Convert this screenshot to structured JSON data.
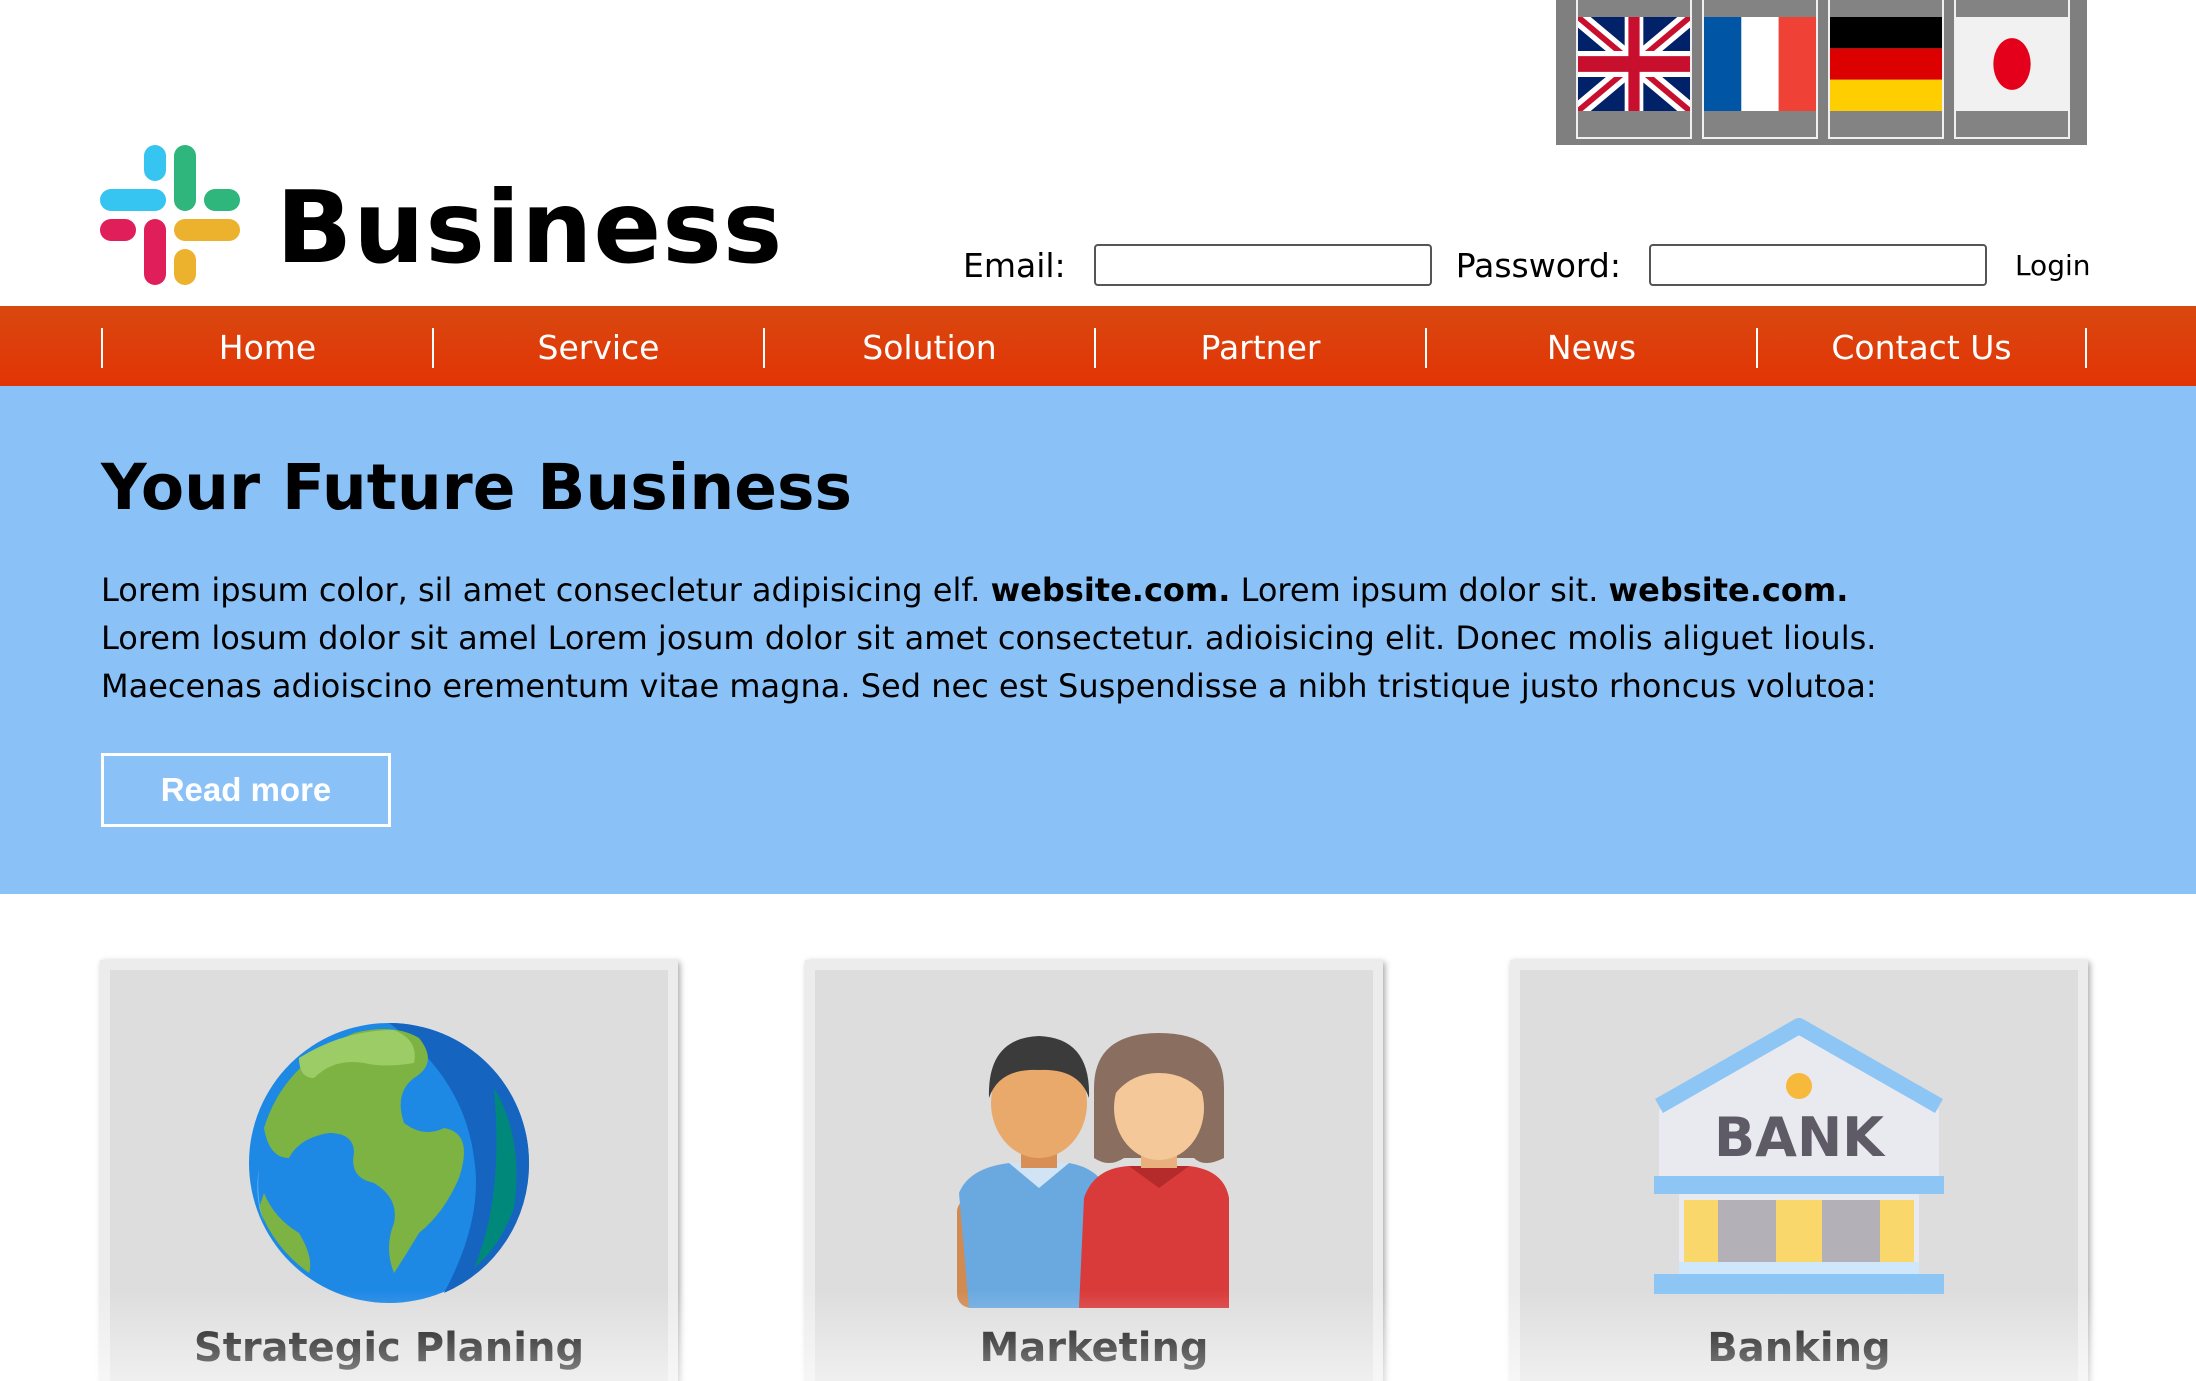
{
  "header": {
    "brand": "Business",
    "logo_icon": "slack-hash-logo-icon",
    "languages": [
      {
        "name": "English",
        "icon": "uk-flag-icon"
      },
      {
        "name": "French",
        "icon": "france-flag-icon"
      },
      {
        "name": "German",
        "icon": "germany-flag-icon"
      },
      {
        "name": "Japanese",
        "icon": "japan-flag-icon"
      }
    ],
    "email_label": "Email:",
    "email_value": "",
    "password_label": "Password:",
    "password_value": "",
    "login_label": "Login"
  },
  "nav": {
    "items": [
      "Home",
      "Service",
      "Solution",
      "Partner",
      "News",
      "Contact Us"
    ],
    "bg_color": "#e33406"
  },
  "hero": {
    "title": "Your Future Business",
    "line1_a": "Lorem ipsum color, sil amet consecletur adipisicing elf. ",
    "line1_b": "website.com.",
    "line1_c": " Lorem ipsum dolor sit. ",
    "line1_d": "website.com.",
    "line2": "Lorem losum dolor sit amel Lorem josum dolor sit amet consectetur. adioisicing elit. Donec molis aliguet liouls.",
    "line3": "Maecenas adioiscino erementum vitae magna. Sed nec est Suspendisse a nibh tristique justo rhoncus volutoa:",
    "read_more": "Read more",
    "bg_color": "#8ac2f7"
  },
  "cards": [
    {
      "title": "Strategic Planing",
      "icon": "globe-icon"
    },
    {
      "title": "Marketing",
      "icon": "people-icon"
    },
    {
      "title": "Banking",
      "icon": "bank-icon",
      "icon_text": "BANK"
    }
  ]
}
